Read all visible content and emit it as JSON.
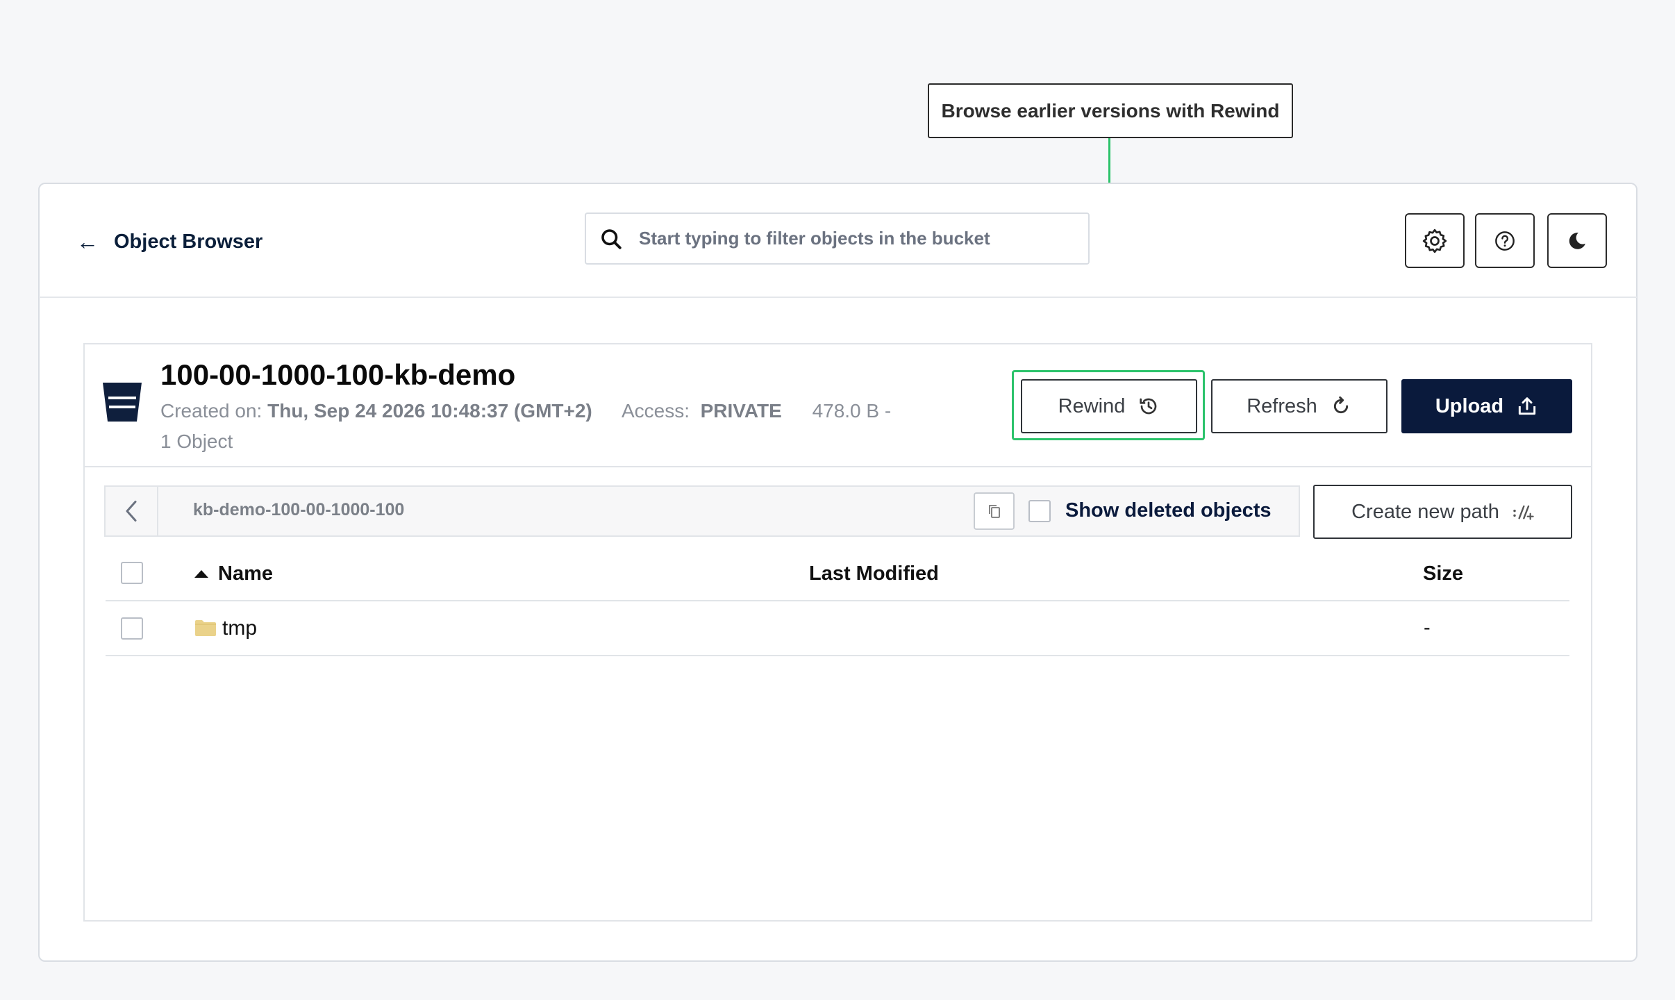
{
  "callout": {
    "text": "Browse earlier versions with Rewind"
  },
  "header": {
    "back_label": "Object Browser",
    "search_placeholder": "Start typing to filter objects in the bucket",
    "icons": [
      "gear-icon",
      "help-icon",
      "moon-icon"
    ]
  },
  "bucket": {
    "name": "100-00-1000-100-kb-demo",
    "created_label": "Created on:",
    "created_value": "Thu, Sep 24 2026 10:48:37 (GMT+2)",
    "access_label": "Access:",
    "access_value": "PRIVATE",
    "size_text": "478.0 B -",
    "objects_text": "1 Object"
  },
  "actions": {
    "rewind_label": "Rewind",
    "refresh_label": "Refresh",
    "upload_label": "Upload"
  },
  "path_bar": {
    "path": "kb-demo-100-00-1000-100",
    "show_deleted_label": "Show deleted objects",
    "show_deleted_checked": false,
    "create_path_label": "Create new path"
  },
  "table": {
    "columns": [
      "Name",
      "Last Modified",
      "Size"
    ],
    "sort": {
      "column": "Name",
      "direction": "asc"
    },
    "rows": [
      {
        "type": "folder",
        "name": "tmp",
        "last_modified": "",
        "size": "-"
      }
    ]
  },
  "colors": {
    "accent_green": "#2cc36b",
    "primary_navy": "#0a1a3c",
    "folder_yellow": "#ead28a"
  }
}
